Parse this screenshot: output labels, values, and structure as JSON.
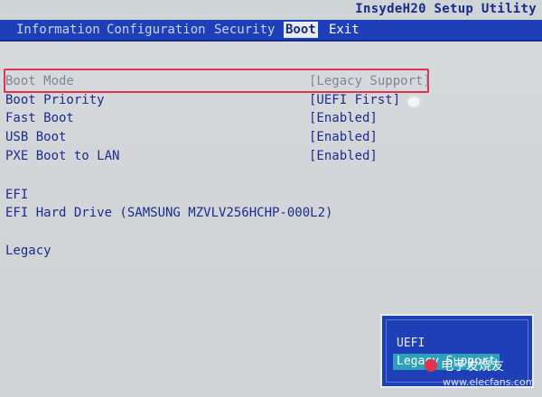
{
  "app": {
    "title": "InsydeH20 Setup Utility"
  },
  "menu": {
    "items": [
      {
        "label": "Information"
      },
      {
        "label": "Configuration"
      },
      {
        "label": "Security"
      },
      {
        "label": "Boot"
      },
      {
        "label": "Exit"
      }
    ],
    "active": "Boot"
  },
  "settings": [
    {
      "label": "Boot Mode",
      "value": "[Legacy Support]"
    },
    {
      "label": "Boot Priority",
      "value": "[UEFI First]"
    },
    {
      "label": "Fast Boot",
      "value": "[Enabled]"
    },
    {
      "label": "USB Boot",
      "value": "[Enabled]"
    },
    {
      "label": "PXE Boot to LAN",
      "value": "[Enabled]"
    }
  ],
  "efi": {
    "heading": "EFI",
    "entry": "EFI Hard Drive (SAMSUNG MZVLV256HCHP-000L2)"
  },
  "legacy": {
    "heading": "Legacy"
  },
  "popup": {
    "options": [
      {
        "label": "UEFI"
      },
      {
        "label": "Legacy Support"
      }
    ],
    "selected": "Legacy Support"
  },
  "watermark": {
    "text": "电子发烧友",
    "url": "www.elecfans.com"
  },
  "colors": {
    "menu_bg": "#1e3fb8",
    "text_blue": "#1c2c8e",
    "highlight_red": "#e0344e",
    "selection_teal": "#2d9fb8"
  }
}
